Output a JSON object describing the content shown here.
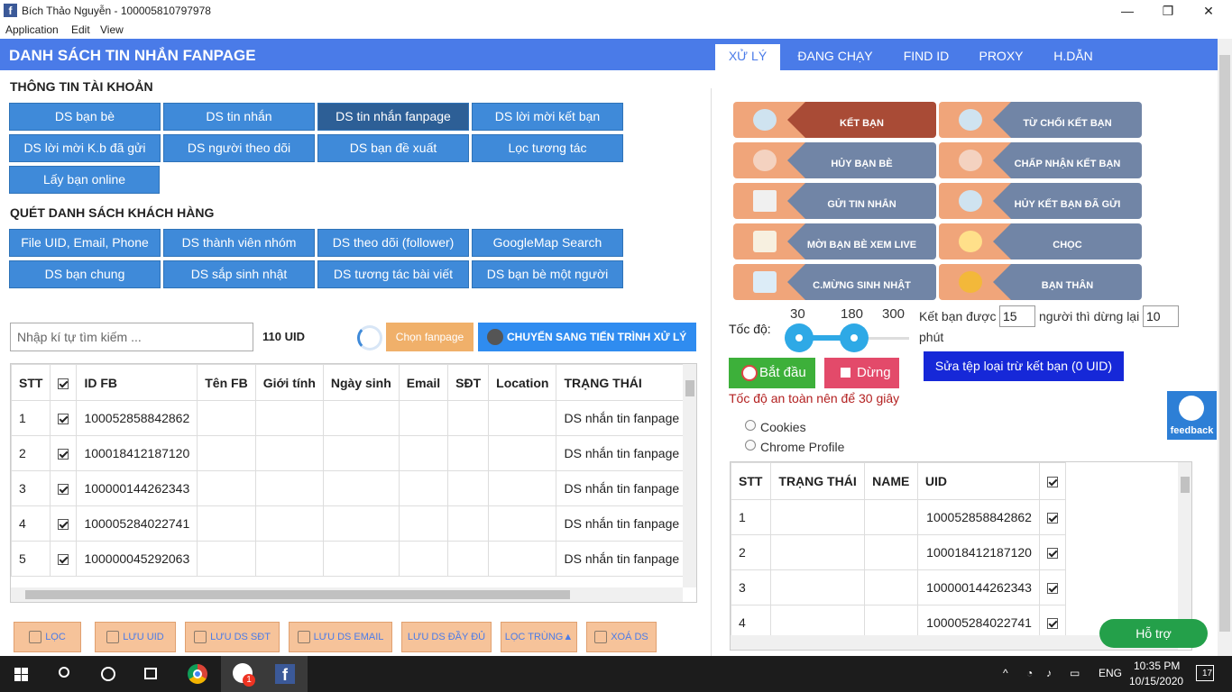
{
  "window": {
    "title": "Bích Thảo Nguyễn - 100005810797978",
    "minimize": "—",
    "maximize": "❐",
    "close": "✕"
  },
  "menu": [
    "Application",
    "Edit",
    "View"
  ],
  "header": {
    "title": "DANH SÁCH TIN NHẮN FANPAGE",
    "tabs": [
      "XỬ LÝ",
      "ĐANG CHẠY",
      "FIND ID",
      "PROXY",
      "H.DẪN"
    ]
  },
  "account_section": {
    "title": "THÔNG TIN TÀI KHOẢN",
    "buttons": [
      "DS bạn bè",
      "DS tin nhắn",
      "DS tin nhắn fanpage",
      "DS lời mời kết bạn",
      "DS lời mời K.b đã gửi",
      "DS người theo dõi",
      "DS bạn đề xuất",
      "Lọc tương tác",
      "Lấy bạn online"
    ]
  },
  "scan_section": {
    "title": "QUÉT DANH SÁCH KHÁCH HÀNG",
    "buttons": [
      "File UID, Email, Phone",
      "DS thành viên nhóm",
      "DS theo dõi (follower)",
      "GoogleMap Search",
      "DS bạn chung",
      "DS sắp sinh nhật",
      "DS tương tác bài viết",
      "DS bạn bè một người"
    ]
  },
  "search": {
    "placeholder": "Nhập kí tự tìm kiếm ...",
    "uid_count": "110 UID",
    "choose_fanpage": "Chọn fanpage",
    "switch_process": "CHUYỂN SANG TIẾN TRÌNH XỬ LÝ"
  },
  "main_table": {
    "columns": [
      "STT",
      "",
      "ID FB",
      "Tên FB",
      "Giới tính",
      "Ngày sinh",
      "Email",
      "SĐT",
      "Location",
      "TRẠNG THÁI"
    ],
    "rows": [
      {
        "stt": "1",
        "id": "100052858842862",
        "status": "DS nhắn tin fanpage"
      },
      {
        "stt": "2",
        "id": "100018412187120",
        "status": "DS nhắn tin fanpage"
      },
      {
        "stt": "3",
        "id": "100000144262343",
        "status": "DS nhắn tin fanpage"
      },
      {
        "stt": "4",
        "id": "100005284022741",
        "status": "DS nhắn tin fanpage"
      },
      {
        "stt": "5",
        "id": "100000045292063",
        "status": "DS nhắn tin fanpage"
      }
    ]
  },
  "bottom_buttons": [
    "LỌC",
    "LƯU UID",
    "LƯU DS SĐT",
    "LƯU DS EMAIL",
    "LƯU DS ĐẦY ĐỦ",
    "LỌC TRÙNG▲",
    "XOÁ DS"
  ],
  "actions": [
    "KẾT BẠN",
    "TỪ CHỐI KẾT BẠN",
    "HỦY BẠN BÈ",
    "CHẤP NHẬN KẾT BẠN",
    "GỬI TIN NHẮN",
    "HỦY KẾT BẠN ĐÃ GỬI",
    "MỜI BẠN BÈ XEM LIVE",
    "CHỌC",
    "C.MỪNG SINH NHẬT",
    "BẠN THÂN"
  ],
  "speed": {
    "label": "Tốc độ:",
    "ticks": [
      "30",
      "180",
      "300"
    ],
    "low": 30,
    "high": 180,
    "min": 30,
    "max": 300,
    "befriend_label": "Kết bạn được",
    "befriend_value": "15",
    "pause_label": "người thì dừng lại",
    "pause_value": "10",
    "minutes": "phút"
  },
  "controls": {
    "start": "Bắt đầu",
    "stop": "Dừng",
    "edit_exclude": "Sửa tệp loại trừ kết bạn (0 UID)",
    "note": "Tốc độ an toàn nên để 30 giây",
    "radio_cookies": "Cookies",
    "radio_chrome": "Chrome Profile"
  },
  "right_table": {
    "columns": [
      "STT",
      "TRẠNG THÁI",
      "NAME",
      "UID",
      ""
    ],
    "rows": [
      {
        "stt": "1",
        "uid": "100052858842862"
      },
      {
        "stt": "2",
        "uid": "100018412187120"
      },
      {
        "stt": "3",
        "uid": "100000144262343"
      },
      {
        "stt": "4",
        "uid": "100005284022741"
      }
    ]
  },
  "feedback": "feedback",
  "support": "Hỗ trợ",
  "taskbar": {
    "lang": "ENG",
    "time": "10:35 PM",
    "date": "10/15/2020",
    "notif": "17",
    "zalo_badge": "1"
  },
  "colors": {
    "header": "#4a7be8",
    "button_blue": "#3f8ad9",
    "action_red": "#a94b36",
    "action_slate": "#7185a6",
    "start_green": "#3db03a",
    "stop_pink": "#e34a6a"
  }
}
